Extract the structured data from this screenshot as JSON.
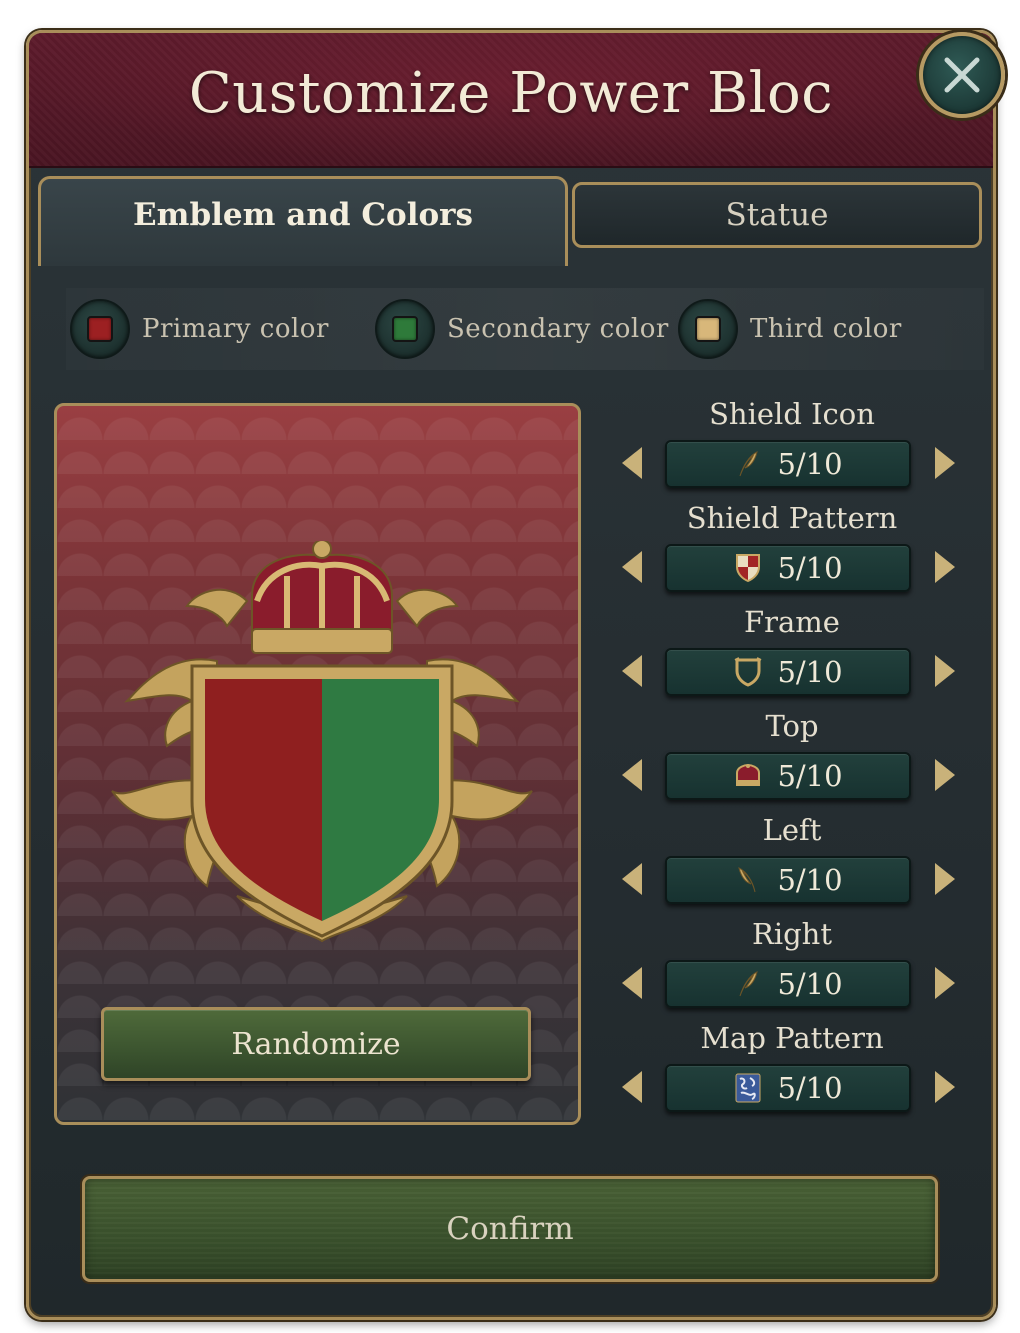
{
  "window": {
    "title": "Customize Power Bloc",
    "close_icon": "close-x-icon"
  },
  "tabs": [
    {
      "label": "Emblem and Colors",
      "active": true
    },
    {
      "label": "Statue",
      "active": false
    }
  ],
  "colors": [
    {
      "label": "Primary color",
      "swatch": "#9c2022"
    },
    {
      "label": "Secondary color",
      "swatch": "#2e7a3a"
    },
    {
      "label": "Third color",
      "swatch": "#d8b77a"
    }
  ],
  "emblem": {
    "shield_left_color": "#8f1f1f",
    "shield_right_color": "#2f7a42",
    "gold": "#c9a864"
  },
  "randomize_label": "Randomize",
  "options": [
    {
      "title": "Shield Icon",
      "value": "5/10",
      "icon": "feather-icon"
    },
    {
      "title": "Shield Pattern",
      "value": "5/10",
      "icon": "quartered-shield-icon"
    },
    {
      "title": "Frame",
      "value": "5/10",
      "icon": "frame-shield-icon"
    },
    {
      "title": "Top",
      "value": "5/10",
      "icon": "crown-icon"
    },
    {
      "title": "Left",
      "value": "5/10",
      "icon": "left-wing-icon"
    },
    {
      "title": "Right",
      "value": "5/10",
      "icon": "right-wing-icon"
    },
    {
      "title": "Map Pattern",
      "value": "5/10",
      "icon": "map-pattern-icon"
    }
  ],
  "confirm_label": "Confirm"
}
